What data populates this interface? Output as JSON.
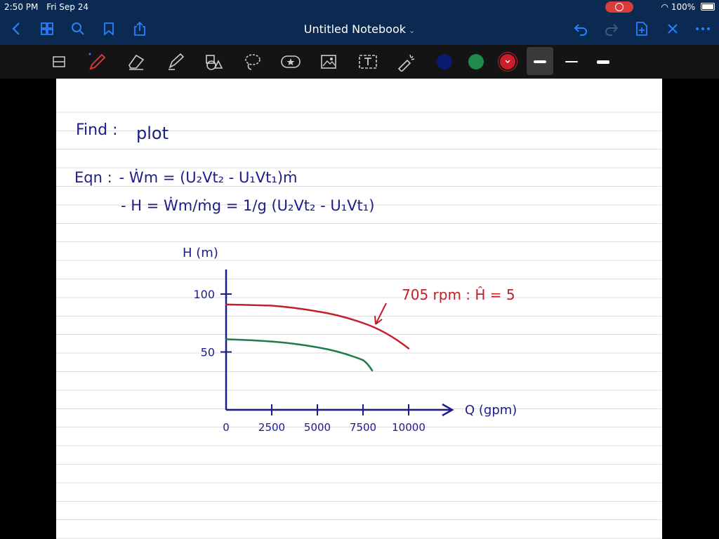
{
  "status": {
    "time": "2:50 PM",
    "date": "Fri Sep 24",
    "battery": "100%"
  },
  "nav": {
    "title": "Untitled Notebook",
    "icons": [
      "chevron-left-icon",
      "grid-icon",
      "search-icon",
      "bookmark-icon",
      "share-icon",
      "undo-icon",
      "redo-icon",
      "add-page-icon",
      "close-icon",
      "more-icon"
    ]
  },
  "toolbar": {
    "tools": [
      "scan-icon",
      "pen-icon",
      "eraser-icon",
      "highlighter-icon",
      "shapes-icon",
      "lasso-icon",
      "sticker-icon",
      "image-icon",
      "text-icon",
      "laser-icon"
    ],
    "colors": [
      "#0a1a6e",
      "#1f8a4a",
      "#cc1f2a"
    ],
    "selected_color": "#cc1f2a"
  },
  "notes": {
    "find_label": "Find :",
    "find_value": "plot",
    "eqn_label": "Eqn :",
    "eqn_line1": "- Ẇm = (U₂Vt₂ - U₁Vt₁)ṁ",
    "eqn_line2": "- H = Ẇm/ṁg = 1/g (U₂Vt₂ - U₁Vt₁)",
    "annotation": "705 rpm : Ĥ = 5"
  },
  "chart_data": {
    "type": "line",
    "ylabel": "H (m)",
    "xlabel": "Q (gpm)",
    "x_ticks": [
      "0",
      "2500",
      "5000",
      "7500",
      "10000"
    ],
    "y_ticks": [
      "50",
      "100"
    ],
    "xlim": [
      0,
      10000
    ],
    "ylim": [
      0,
      100
    ],
    "series": [
      {
        "color": "#c0202a",
        "x": [
          0,
          2500,
          5000,
          7500,
          10000
        ],
        "y": [
          91,
          90,
          85,
          75,
          53
        ]
      },
      {
        "color": "#1f7a4a",
        "x": [
          0,
          2500,
          5000,
          7500,
          8000
        ],
        "y": [
          61,
          59,
          54,
          43,
          34
        ]
      }
    ]
  }
}
